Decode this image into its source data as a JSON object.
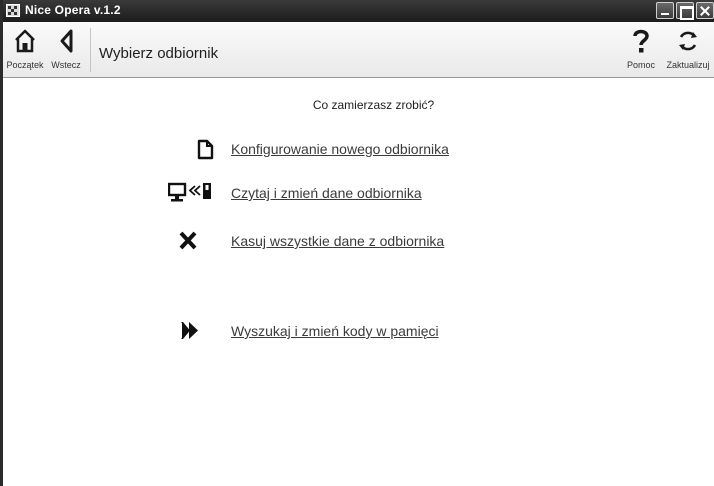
{
  "window": {
    "title": "Nice Opera v.1.2",
    "controls": {
      "minimize": "minimize-icon",
      "maximize": "maximize-icon",
      "close": "close-icon"
    }
  },
  "toolbar": {
    "start_label": "Początek",
    "back_label": "Wstecz",
    "help_label": "Pomoc",
    "update_label": "Zaktualizuj",
    "page_title": "Wybierz odbiornik"
  },
  "main": {
    "question": "Co zamierzasz zrobić?",
    "actions": [
      {
        "icon": "new-document-icon",
        "label": "Konfigurowanie nowego odbiornika"
      },
      {
        "icon": "computer-receiver-transfer-icon",
        "label": "Czytaj i zmień dane odbiornika"
      },
      {
        "icon": "delete-x-icon",
        "label": "Kasuj wszystkie dane z odbiornika"
      },
      {
        "icon": "double-arrow-icon",
        "label": "Wyszukaj i zmień kody w pamięci"
      }
    ]
  },
  "colors": {
    "titlebar": "#2a2a2a",
    "toolbar": "#f0f0f0",
    "link": "#3b3b3b",
    "background": "#ffffff"
  }
}
